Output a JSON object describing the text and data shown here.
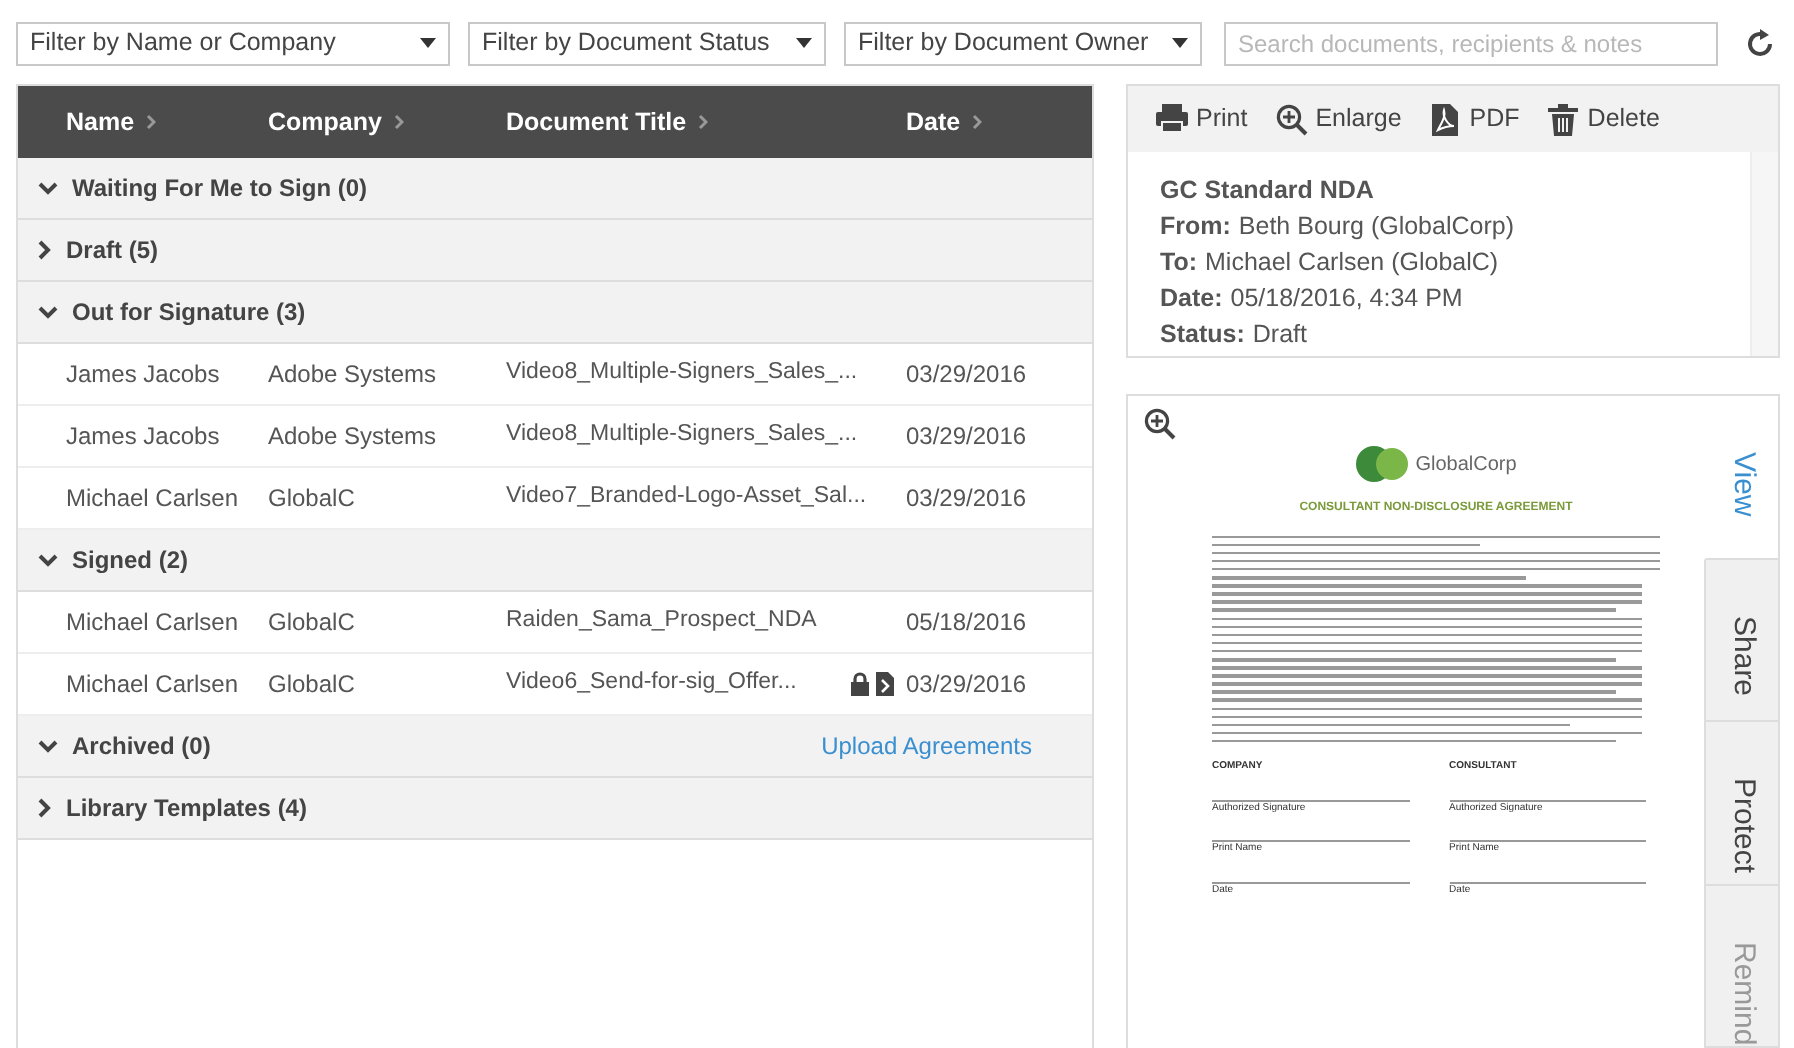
{
  "filters": [
    {
      "label": "Filter by Name or Company"
    },
    {
      "label": "Filter by Document Status"
    },
    {
      "label": "Filter by Document Owner"
    }
  ],
  "search": {
    "placeholder": "Search documents, recipients & notes"
  },
  "table": {
    "columns": [
      "Name",
      "Company",
      "Document Title",
      "Date"
    ],
    "groups": [
      {
        "label": "Waiting For Me to Sign (0)",
        "expanded": true
      },
      {
        "label": "Draft (5)",
        "expanded": false
      },
      {
        "label": "Out for Signature (3)",
        "expanded": true,
        "rows": [
          {
            "name": "James Jacobs",
            "company": "Adobe Systems",
            "title": "Video8_Multiple-Signers_Sales_...",
            "date": "03/29/2016",
            "locked": false,
            "attachment": false
          },
          {
            "name": "James Jacobs",
            "company": "Adobe Systems",
            "title": "Video8_Multiple-Signers_Sales_...",
            "date": "03/29/2016",
            "locked": false,
            "attachment": false
          },
          {
            "name": "Michael Carlsen",
            "company": "GlobalC",
            "title": "Video7_Branded-Logo-Asset_Sal...",
            "date": "03/29/2016",
            "locked": false,
            "attachment": false
          }
        ]
      },
      {
        "label": "Signed (2)",
        "expanded": true,
        "rows": [
          {
            "name": "Michael Carlsen",
            "company": "GlobalC",
            "title": "Raiden_Sama_Prospect_NDA",
            "date": "05/18/2016",
            "locked": false,
            "attachment": false
          },
          {
            "name": "Michael Carlsen",
            "company": "GlobalC",
            "title": "Video6_Send-for-sig_Offer...",
            "date": "03/29/2016",
            "locked": true,
            "attachment": true
          }
        ]
      },
      {
        "label": "Archived (0)",
        "expanded": true,
        "action": "Upload Agreements"
      },
      {
        "label": "Library Templates (4)",
        "expanded": false
      }
    ]
  },
  "toolbar": [
    {
      "label": "Print",
      "kind": "print"
    },
    {
      "label": "Enlarge",
      "kind": "enlarge"
    },
    {
      "label": "PDF",
      "kind": "pdf"
    },
    {
      "label": "Delete",
      "kind": "delete"
    }
  ],
  "details": {
    "title": "GC Standard NDA",
    "fields": [
      {
        "label": "From:",
        "value": "Beth Bourg (GlobalCorp)"
      },
      {
        "label": "To:",
        "value": "Michael Carlsen (GlobalC)"
      },
      {
        "label": "Date:",
        "value": "05/18/2016, 4:34 PM"
      },
      {
        "label": "Status:",
        "value": "Draft"
      }
    ]
  },
  "preview": {
    "logo_text": "GlobalCorp",
    "heading": "CONSULTANT NON-DISCLOSURE AGREEMENT",
    "signature_columns": [
      {
        "heading": "COMPANY",
        "lines": [
          "Authorized Signature",
          "Print Name",
          "Date"
        ]
      },
      {
        "heading": "CONSULTANT",
        "lines": [
          "Authorized Signature",
          "Print Name",
          "Date"
        ]
      }
    ]
  },
  "side_tabs": [
    {
      "label": "View",
      "selected": true,
      "disabled": false
    },
    {
      "label": "Share",
      "selected": false,
      "disabled": false
    },
    {
      "label": "Protect",
      "selected": false,
      "disabled": false
    },
    {
      "label": "Remind",
      "selected": false,
      "disabled": true
    }
  ]
}
